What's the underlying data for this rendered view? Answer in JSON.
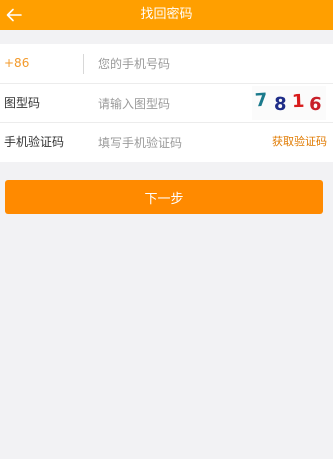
{
  "header": {
    "title": "找回密码",
    "back_icon": "arrow-left-icon",
    "background_color": "#ff9f00"
  },
  "form": {
    "phone": {
      "country_code": "+86",
      "placeholder": "您的手机号码",
      "value": ""
    },
    "captcha": {
      "label": "图型码",
      "placeholder": "请输入图型码",
      "value": "",
      "image_digits": [
        "7",
        "8",
        "1",
        "6"
      ],
      "digit_colors": [
        "#1b7a8c",
        "#1f2d88",
        "#d81b1b",
        "#c8202a"
      ]
    },
    "sms": {
      "label": "手机验证码",
      "placeholder": "填写手机验证码",
      "value": "",
      "get_code_label": "获取验证码"
    }
  },
  "next_button": {
    "label": "下一步",
    "color": "#ff8a00"
  }
}
